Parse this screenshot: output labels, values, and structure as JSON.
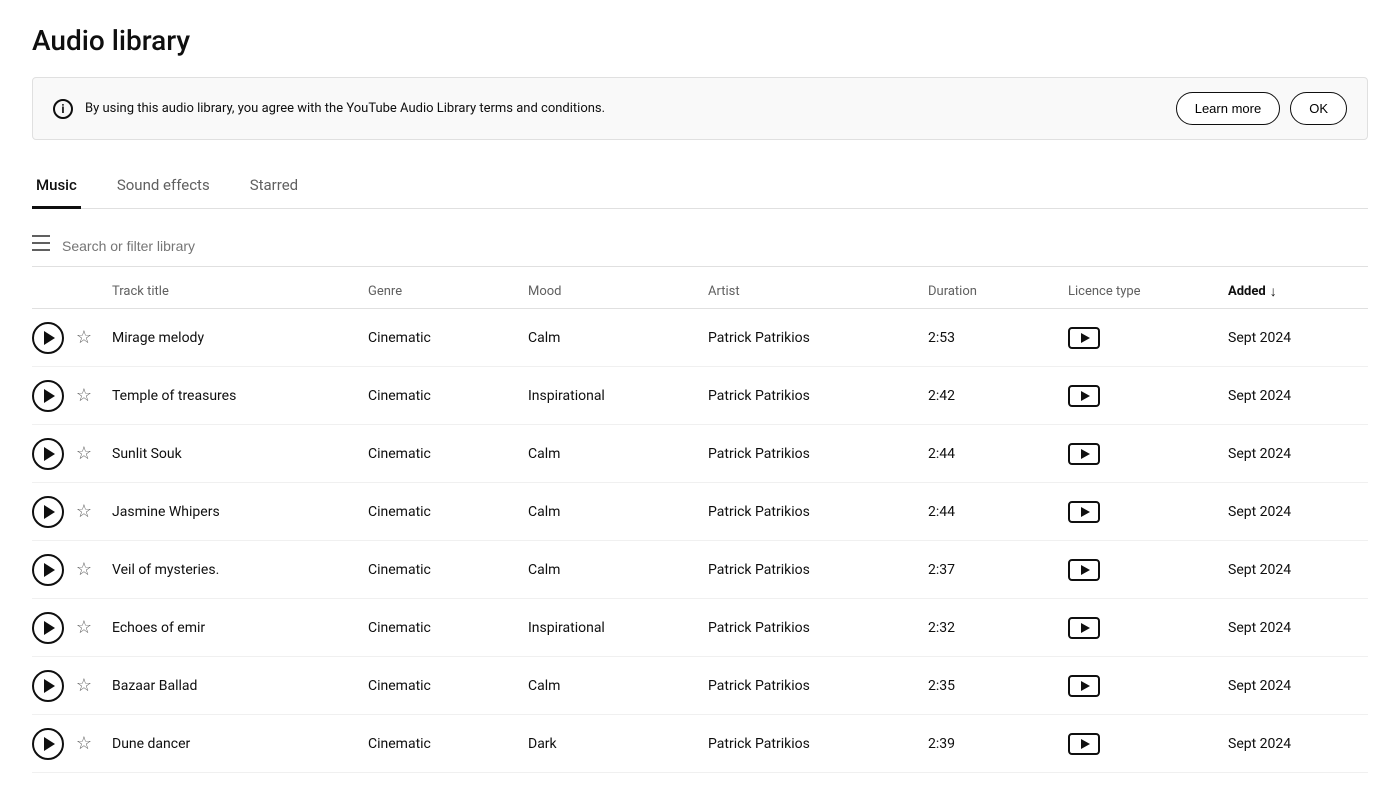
{
  "page": {
    "title": "Audio library"
  },
  "notice": {
    "text": "By using this audio library, you agree with the YouTube Audio Library terms and conditions.",
    "learn_more_label": "Learn more",
    "ok_label": "OK"
  },
  "tabs": [
    {
      "id": "music",
      "label": "Music",
      "active": true
    },
    {
      "id": "sound-effects",
      "label": "Sound effects",
      "active": false
    },
    {
      "id": "starred",
      "label": "Starred",
      "active": false
    }
  ],
  "search": {
    "placeholder": "Search or filter library"
  },
  "table": {
    "columns": {
      "play": "",
      "star": "",
      "track_title": "Track title",
      "genre": "Genre",
      "mood": "Mood",
      "artist": "Artist",
      "duration": "Duration",
      "licence_type": "Licence type",
      "added": "Added"
    },
    "tracks": [
      {
        "title": "Mirage melody",
        "genre": "Cinematic",
        "mood": "Calm",
        "artist": "Patrick Patrikios",
        "duration": "2:53",
        "added": "Sept 2024"
      },
      {
        "title": "Temple of treasures",
        "genre": "Cinematic",
        "mood": "Inspirational",
        "artist": "Patrick Patrikios",
        "duration": "2:42",
        "added": "Sept 2024"
      },
      {
        "title": "Sunlit Souk",
        "genre": "Cinematic",
        "mood": "Calm",
        "artist": "Patrick Patrikios",
        "duration": "2:44",
        "added": "Sept 2024"
      },
      {
        "title": "Jasmine Whipers",
        "genre": "Cinematic",
        "mood": "Calm",
        "artist": "Patrick Patrikios",
        "duration": "2:44",
        "added": "Sept 2024"
      },
      {
        "title": "Veil of mysteries.",
        "genre": "Cinematic",
        "mood": "Calm",
        "artist": "Patrick Patrikios",
        "duration": "2:37",
        "added": "Sept 2024"
      },
      {
        "title": "Echoes of emir",
        "genre": "Cinematic",
        "mood": "Inspirational",
        "artist": "Patrick Patrikios",
        "duration": "2:32",
        "added": "Sept 2024"
      },
      {
        "title": "Bazaar Ballad",
        "genre": "Cinematic",
        "mood": "Calm",
        "artist": "Patrick Patrikios",
        "duration": "2:35",
        "added": "Sept 2024"
      },
      {
        "title": "Dune dancer",
        "genre": "Cinematic",
        "mood": "Dark",
        "artist": "Patrick Patrikios",
        "duration": "2:39",
        "added": "Sept 2024"
      }
    ]
  }
}
